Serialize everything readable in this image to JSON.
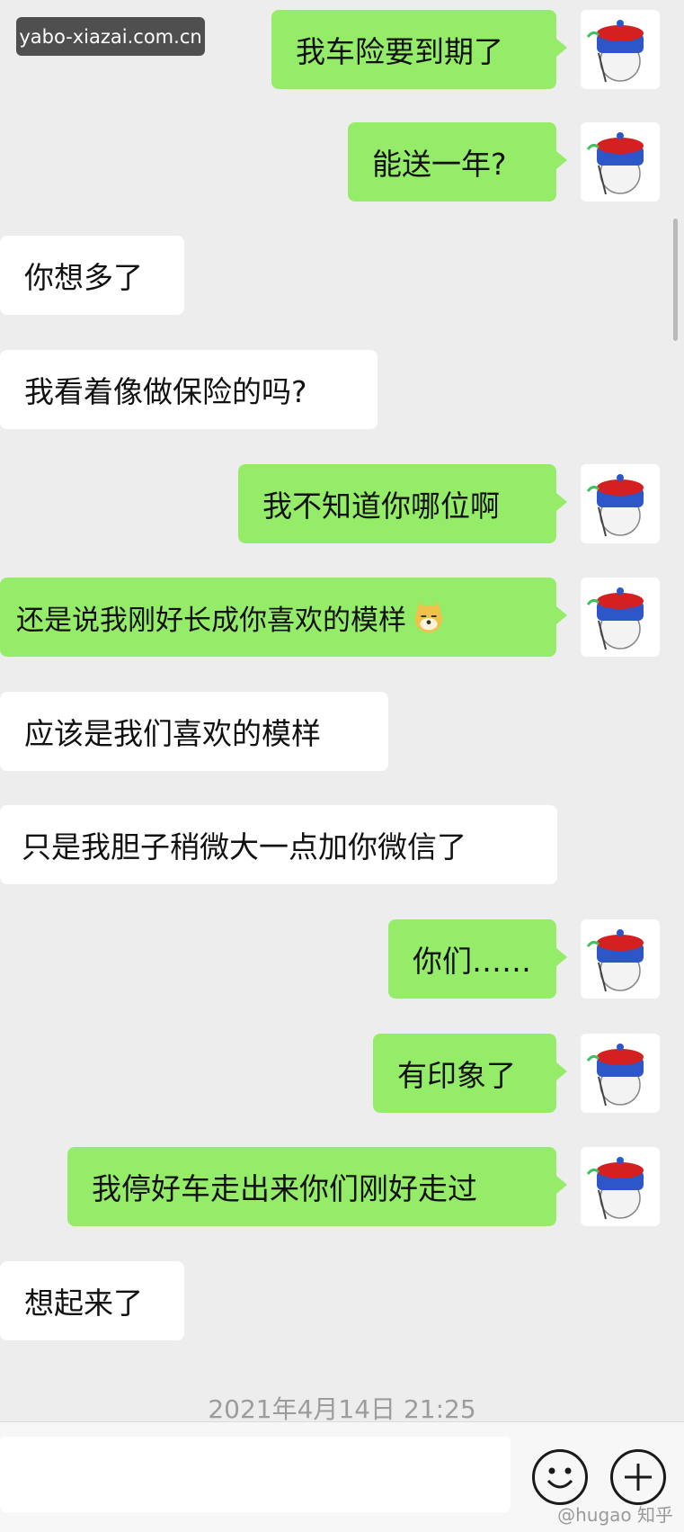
{
  "watermark": "yabo-xiazai.com.cn",
  "messages": [
    {
      "side": "out",
      "text": "我车险要到期了"
    },
    {
      "side": "out",
      "text": "能送一年?"
    },
    {
      "side": "in",
      "text": "你想多了"
    },
    {
      "side": "in",
      "text": "我看着像做保险的吗?"
    },
    {
      "side": "out",
      "text": "我不知道你哪位啊"
    },
    {
      "side": "out",
      "text": "还是说我刚好长成你喜欢的模样"
    },
    {
      "side": "in",
      "text": "应该是我们喜欢的模样"
    },
    {
      "side": "in",
      "text": "只是我胆子稍微大一点加你微信了"
    },
    {
      "side": "out",
      "text": "你们……"
    },
    {
      "side": "out",
      "text": "有印象了"
    },
    {
      "side": "out",
      "text": "我停好车走出来你们刚好走过"
    },
    {
      "side": "in",
      "text": "想起来了"
    }
  ],
  "timestamp": "2021年4月14日 21:25",
  "credit": "@hugao 知乎"
}
